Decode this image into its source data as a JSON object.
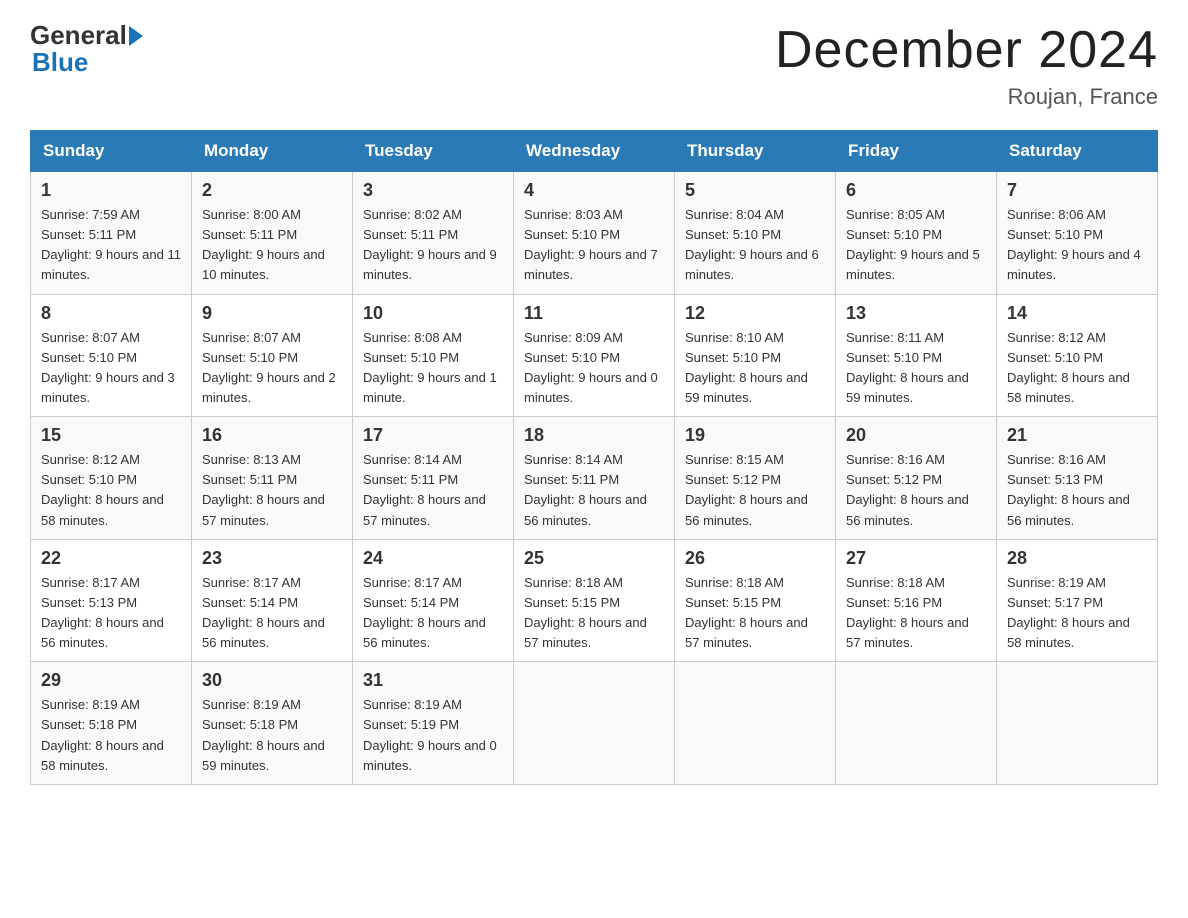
{
  "header": {
    "logo_general": "General",
    "logo_blue": "Blue",
    "title": "December 2024",
    "location": "Roujan, France"
  },
  "columns": [
    "Sunday",
    "Monday",
    "Tuesday",
    "Wednesday",
    "Thursday",
    "Friday",
    "Saturday"
  ],
  "weeks": [
    [
      {
        "day": "1",
        "sunrise": "Sunrise: 7:59 AM",
        "sunset": "Sunset: 5:11 PM",
        "daylight": "Daylight: 9 hours and 11 minutes."
      },
      {
        "day": "2",
        "sunrise": "Sunrise: 8:00 AM",
        "sunset": "Sunset: 5:11 PM",
        "daylight": "Daylight: 9 hours and 10 minutes."
      },
      {
        "day": "3",
        "sunrise": "Sunrise: 8:02 AM",
        "sunset": "Sunset: 5:11 PM",
        "daylight": "Daylight: 9 hours and 9 minutes."
      },
      {
        "day": "4",
        "sunrise": "Sunrise: 8:03 AM",
        "sunset": "Sunset: 5:10 PM",
        "daylight": "Daylight: 9 hours and 7 minutes."
      },
      {
        "day": "5",
        "sunrise": "Sunrise: 8:04 AM",
        "sunset": "Sunset: 5:10 PM",
        "daylight": "Daylight: 9 hours and 6 minutes."
      },
      {
        "day": "6",
        "sunrise": "Sunrise: 8:05 AM",
        "sunset": "Sunset: 5:10 PM",
        "daylight": "Daylight: 9 hours and 5 minutes."
      },
      {
        "day": "7",
        "sunrise": "Sunrise: 8:06 AM",
        "sunset": "Sunset: 5:10 PM",
        "daylight": "Daylight: 9 hours and 4 minutes."
      }
    ],
    [
      {
        "day": "8",
        "sunrise": "Sunrise: 8:07 AM",
        "sunset": "Sunset: 5:10 PM",
        "daylight": "Daylight: 9 hours and 3 minutes."
      },
      {
        "day": "9",
        "sunrise": "Sunrise: 8:07 AM",
        "sunset": "Sunset: 5:10 PM",
        "daylight": "Daylight: 9 hours and 2 minutes."
      },
      {
        "day": "10",
        "sunrise": "Sunrise: 8:08 AM",
        "sunset": "Sunset: 5:10 PM",
        "daylight": "Daylight: 9 hours and 1 minute."
      },
      {
        "day": "11",
        "sunrise": "Sunrise: 8:09 AM",
        "sunset": "Sunset: 5:10 PM",
        "daylight": "Daylight: 9 hours and 0 minutes."
      },
      {
        "day": "12",
        "sunrise": "Sunrise: 8:10 AM",
        "sunset": "Sunset: 5:10 PM",
        "daylight": "Daylight: 8 hours and 59 minutes."
      },
      {
        "day": "13",
        "sunrise": "Sunrise: 8:11 AM",
        "sunset": "Sunset: 5:10 PM",
        "daylight": "Daylight: 8 hours and 59 minutes."
      },
      {
        "day": "14",
        "sunrise": "Sunrise: 8:12 AM",
        "sunset": "Sunset: 5:10 PM",
        "daylight": "Daylight: 8 hours and 58 minutes."
      }
    ],
    [
      {
        "day": "15",
        "sunrise": "Sunrise: 8:12 AM",
        "sunset": "Sunset: 5:10 PM",
        "daylight": "Daylight: 8 hours and 58 minutes."
      },
      {
        "day": "16",
        "sunrise": "Sunrise: 8:13 AM",
        "sunset": "Sunset: 5:11 PM",
        "daylight": "Daylight: 8 hours and 57 minutes."
      },
      {
        "day": "17",
        "sunrise": "Sunrise: 8:14 AM",
        "sunset": "Sunset: 5:11 PM",
        "daylight": "Daylight: 8 hours and 57 minutes."
      },
      {
        "day": "18",
        "sunrise": "Sunrise: 8:14 AM",
        "sunset": "Sunset: 5:11 PM",
        "daylight": "Daylight: 8 hours and 56 minutes."
      },
      {
        "day": "19",
        "sunrise": "Sunrise: 8:15 AM",
        "sunset": "Sunset: 5:12 PM",
        "daylight": "Daylight: 8 hours and 56 minutes."
      },
      {
        "day": "20",
        "sunrise": "Sunrise: 8:16 AM",
        "sunset": "Sunset: 5:12 PM",
        "daylight": "Daylight: 8 hours and 56 minutes."
      },
      {
        "day": "21",
        "sunrise": "Sunrise: 8:16 AM",
        "sunset": "Sunset: 5:13 PM",
        "daylight": "Daylight: 8 hours and 56 minutes."
      }
    ],
    [
      {
        "day": "22",
        "sunrise": "Sunrise: 8:17 AM",
        "sunset": "Sunset: 5:13 PM",
        "daylight": "Daylight: 8 hours and 56 minutes."
      },
      {
        "day": "23",
        "sunrise": "Sunrise: 8:17 AM",
        "sunset": "Sunset: 5:14 PM",
        "daylight": "Daylight: 8 hours and 56 minutes."
      },
      {
        "day": "24",
        "sunrise": "Sunrise: 8:17 AM",
        "sunset": "Sunset: 5:14 PM",
        "daylight": "Daylight: 8 hours and 56 minutes."
      },
      {
        "day": "25",
        "sunrise": "Sunrise: 8:18 AM",
        "sunset": "Sunset: 5:15 PM",
        "daylight": "Daylight: 8 hours and 57 minutes."
      },
      {
        "day": "26",
        "sunrise": "Sunrise: 8:18 AM",
        "sunset": "Sunset: 5:15 PM",
        "daylight": "Daylight: 8 hours and 57 minutes."
      },
      {
        "day": "27",
        "sunrise": "Sunrise: 8:18 AM",
        "sunset": "Sunset: 5:16 PM",
        "daylight": "Daylight: 8 hours and 57 minutes."
      },
      {
        "day": "28",
        "sunrise": "Sunrise: 8:19 AM",
        "sunset": "Sunset: 5:17 PM",
        "daylight": "Daylight: 8 hours and 58 minutes."
      }
    ],
    [
      {
        "day": "29",
        "sunrise": "Sunrise: 8:19 AM",
        "sunset": "Sunset: 5:18 PM",
        "daylight": "Daylight: 8 hours and 58 minutes."
      },
      {
        "day": "30",
        "sunrise": "Sunrise: 8:19 AM",
        "sunset": "Sunset: 5:18 PM",
        "daylight": "Daylight: 8 hours and 59 minutes."
      },
      {
        "day": "31",
        "sunrise": "Sunrise: 8:19 AM",
        "sunset": "Sunset: 5:19 PM",
        "daylight": "Daylight: 9 hours and 0 minutes."
      },
      null,
      null,
      null,
      null
    ]
  ]
}
